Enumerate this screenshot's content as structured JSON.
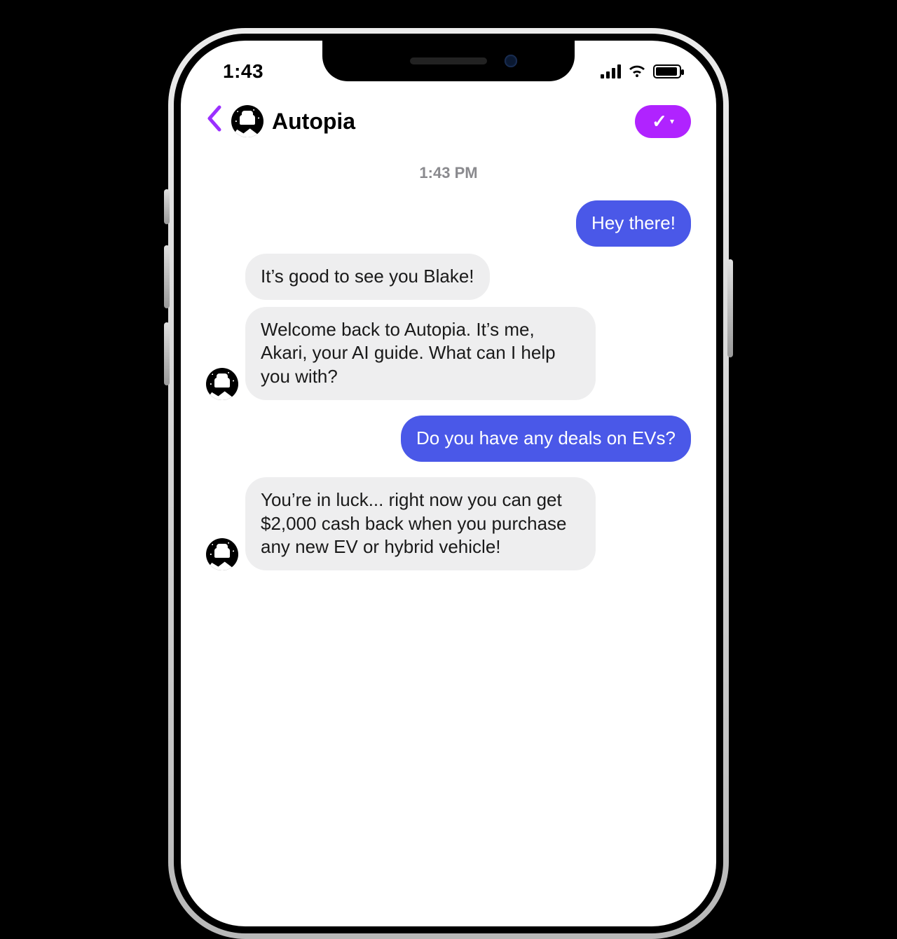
{
  "status": {
    "time": "1:43"
  },
  "nav": {
    "title": "Autopia"
  },
  "icons": {
    "back": "back-chevron-icon",
    "check": "checkmark-icon",
    "dropdown": "dropdown-caret-icon",
    "cellular": "cellular-signal-icon",
    "wifi": "wifi-icon",
    "battery": "battery-icon",
    "brand_avatar": "autopia-logo-icon"
  },
  "chat": {
    "timestamp": "1:43 PM",
    "messages": [
      {
        "sender": "user",
        "text": "Hey there!"
      },
      {
        "sender": "bot",
        "text": "It’s good to see you Blake!"
      },
      {
        "sender": "bot",
        "text": "Welcome back to Autopia. It’s me, Akari, your AI guide. What can I help you with?"
      },
      {
        "sender": "user",
        "text": "Do you have any deals on EVs?"
      },
      {
        "sender": "bot",
        "text": "You’re in luck... right now you can get $2,000 cash back when you purchase any new EV or hybrid vehicle!"
      }
    ]
  },
  "colors": {
    "accent_purple": "#b023ff",
    "user_bubble": "#4a58e8",
    "bot_bubble": "#eeeeef"
  }
}
